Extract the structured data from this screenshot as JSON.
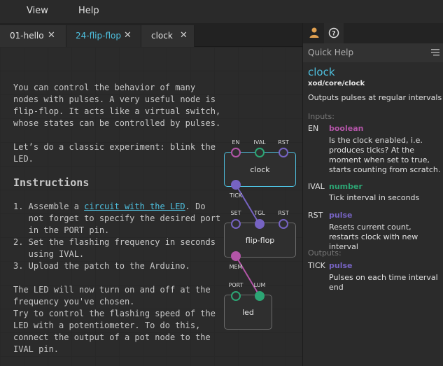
{
  "menu": {
    "view": "View",
    "help": "Help"
  },
  "tabs": [
    {
      "label": "01-hello",
      "close": "✕"
    },
    {
      "label": "24-flip-flop",
      "close": "✕",
      "active": true
    },
    {
      "label": "clock",
      "close": "✕"
    }
  ],
  "comment": {
    "intro": "You can control the behavior of many\nnodes with pulses. A very useful node is\nflip-flop. It acts like a virtual switch,\nwhose states can be controlled by pulses.",
    "classic": "Let’s do a classic experiment: blink the\nLED.",
    "heading": "Instructions",
    "step1_prefix": "1. Assemble a ",
    "step1_link": "circuit with the LED",
    "step1_suffix": ". Do\n   not forget to specify the desired port\n   in the PORT pin.",
    "step2": "2. Set the flashing frequency in seconds\n   using IVAL.",
    "step3": "3. Upload the patch to the Arduino.",
    "outro": "The LED will now turn on and off at the\nfrequency you've chosen.\nTry to control the flashing speed of the\nLED with a potentiometer. To do this,\nconnect the output of a pot node to the\nIVAL pin."
  },
  "nodes": {
    "clock": {
      "title": "clock",
      "pins_in": [
        "EN",
        "IVAL",
        "RST"
      ],
      "pin_out": "TICK"
    },
    "flipflop": {
      "title": "flip-flop",
      "pins_in": [
        "SET",
        "TGL",
        "RST"
      ],
      "pin_out": "MEM"
    },
    "led": {
      "title": "led",
      "pins_in": [
        "PORT",
        "LUM"
      ]
    }
  },
  "colors": {
    "accent": "#4ec0df",
    "boolean": "#b355a7",
    "number": "#2ca574",
    "pulse": "#7663c2"
  },
  "panel": {
    "tab_icons": [
      "user-icon",
      "help-circle-icon"
    ],
    "title": "Quick Help",
    "node_name": "clock",
    "node_path": "xod/core/clock",
    "node_desc": "Outputs pulses at regular intervals",
    "inputs_label": "Inputs:",
    "inputs": [
      {
        "name": "EN",
        "type": "boolean",
        "desc": "Is the clock enabled, i.e. produces ticks? At the moment when set to true, starts counting from scratch."
      },
      {
        "name": "IVAL",
        "type": "number",
        "desc": "Tick interval in seconds"
      },
      {
        "name": "RST",
        "type": "pulse",
        "desc": "Resets current count, restarts clock with new interval"
      }
    ],
    "outputs_label": "Outputs:",
    "outputs": [
      {
        "name": "TICK",
        "type": "pulse",
        "desc": "Pulses on each time interval end"
      }
    ]
  }
}
